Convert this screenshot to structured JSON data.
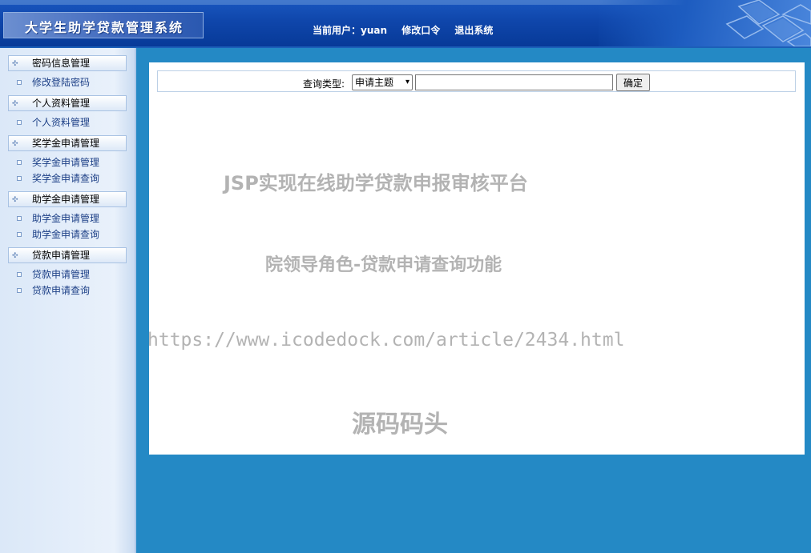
{
  "header": {
    "system_title": "大学生助学贷款管理系统",
    "current_user_label": "当前用户：",
    "current_user": "yuan",
    "change_password_link": "修改口令",
    "logout_link": "退出系统"
  },
  "sidebar": {
    "groups": [
      {
        "title": "密码信息管理",
        "items": [
          {
            "label": "修改登陆密码"
          }
        ]
      },
      {
        "title": "个人资料管理",
        "items": [
          {
            "label": "个人资料管理"
          }
        ]
      },
      {
        "title": "奖学金申请管理",
        "items": [
          {
            "label": "奖学金申请管理"
          },
          {
            "label": "奖学金申请查询"
          }
        ]
      },
      {
        "title": "助学金申请管理",
        "items": [
          {
            "label": "助学金申请管理"
          },
          {
            "label": "助学金申请查询"
          }
        ]
      },
      {
        "title": "贷款申请管理",
        "items": [
          {
            "label": "贷款申请管理"
          },
          {
            "label": "贷款申请查询"
          }
        ]
      }
    ]
  },
  "search": {
    "label": "查询类型:",
    "selected_type": "申请主题",
    "input_value": "",
    "submit_label": "确定"
  },
  "watermarks": {
    "line1": "JSP实现在线助学贷款申报审核平台",
    "line2": "院领导角色-贷款申请查询功能",
    "line3": "https://www.icodedock.com/article/2434.html",
    "line4": "源码码头"
  },
  "colors": {
    "header_blue": "#0f46ab",
    "background_blue": "#2489c5",
    "sidebar_link": "#1c3f86"
  }
}
